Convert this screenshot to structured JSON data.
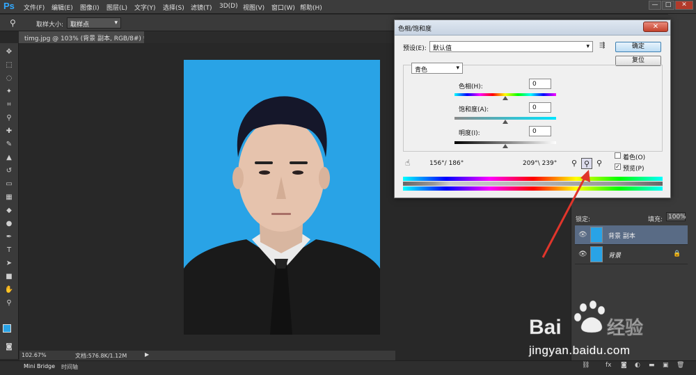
{
  "app": {
    "logo": "Ps"
  },
  "menu": [
    "文件(F)",
    "编辑(E)",
    "图像(I)",
    "图层(L)",
    "文字(Y)",
    "选择(S)",
    "滤镜(T)",
    "3D(D)",
    "视图(V)",
    "窗口(W)",
    "帮助(H)"
  ],
  "window_controls": {
    "minimize": "—",
    "restore": "□",
    "close": "✕"
  },
  "options": {
    "sample_size_label": "取样大小:",
    "sample_size_value": "取样点"
  },
  "document_tab": "timg.jpg @ 103% (背景 副本, RGB/8#) *",
  "status": {
    "zoom": "102.67%",
    "doc": "文档:576.8K/1.12M"
  },
  "bottom_tabs": [
    "Mini Bridge",
    "时间轴"
  ],
  "dialog": {
    "title": "色相/饱和度",
    "close": "✕",
    "preset_label": "预设(E):",
    "preset_value": "默认值",
    "ok": "确定",
    "reset": "复位",
    "channel": "青色",
    "hue_label": "色相(H):",
    "hue_value": "0",
    "sat_label": "饱和度(A):",
    "sat_value": "0",
    "light_label": "明度(I):",
    "light_value": "0",
    "range_left": "156°/ 186°",
    "range_right": "209°\\ 239°",
    "colorize_label": "着色(O)",
    "colorize_checked": false,
    "preview_label": "预览(P)",
    "preview_checked": true
  },
  "layers": {
    "lock_label": "锁定:",
    "fill_label": "填充:",
    "fill_value": "100%",
    "items": [
      {
        "name": "背景 副本",
        "selected": true
      },
      {
        "name": "背景",
        "selected": false,
        "locked": true
      }
    ]
  },
  "watermark": {
    "text": "jingyan.baidu.com",
    "brand": "Bai du 经验"
  },
  "colors": {
    "accent": "#31a8ff",
    "photo_bg": "#29a3e6",
    "arrow": "#e0352b"
  }
}
